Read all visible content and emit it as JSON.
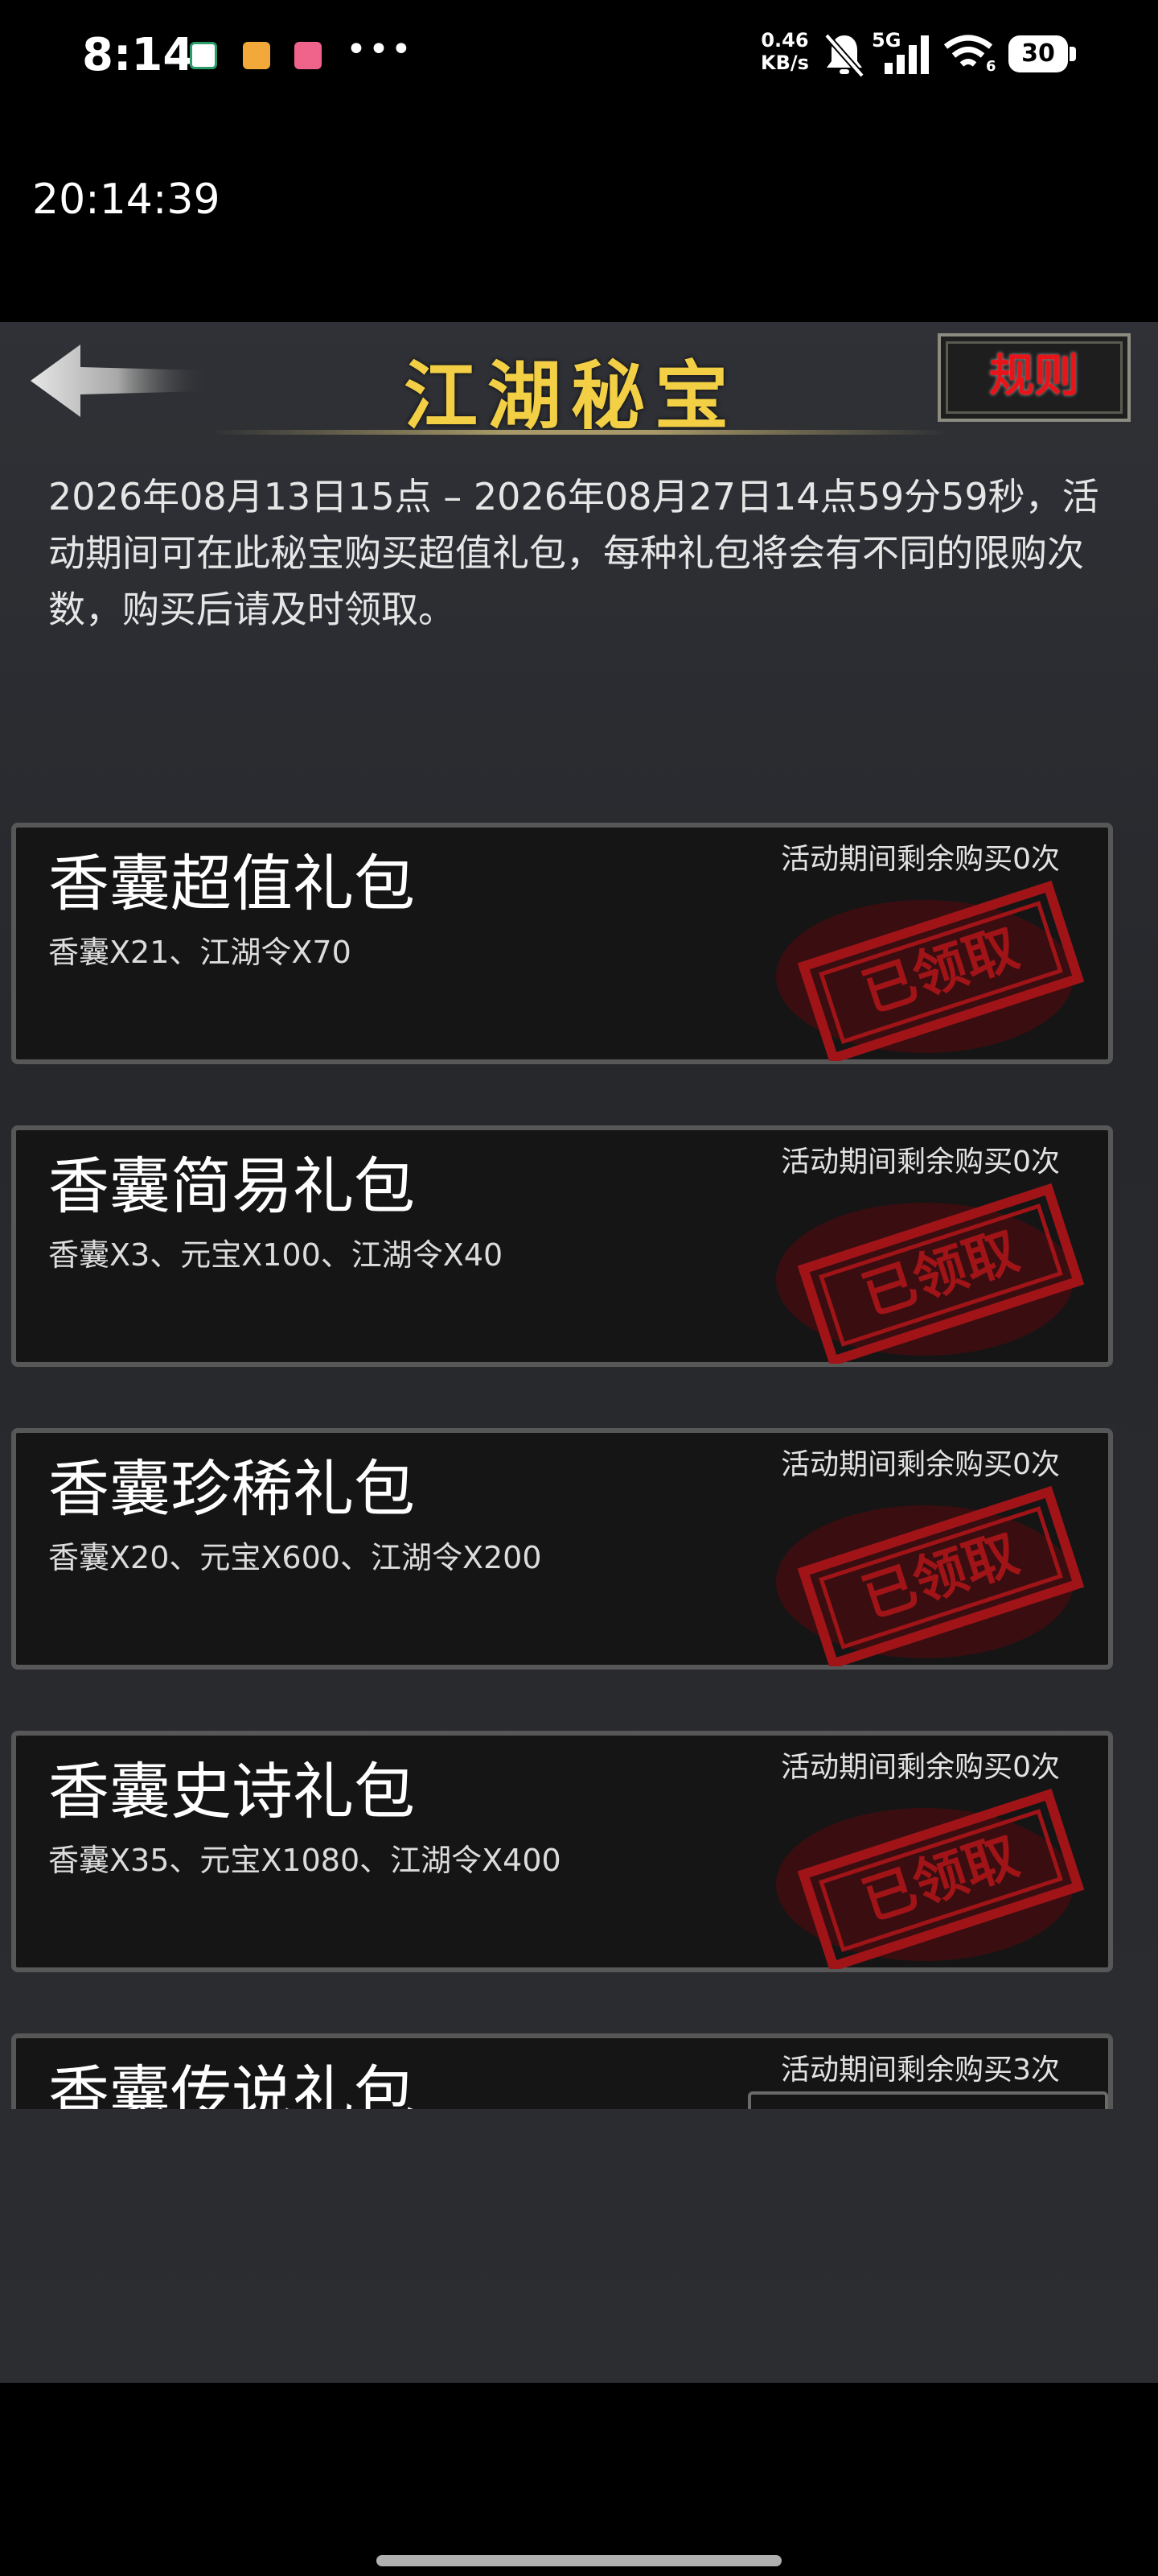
{
  "status_bar": {
    "time": "8:14",
    "notification_dots": "•••",
    "net_speed_value": "0.46",
    "net_speed_unit": "KB/s",
    "network_type": "5G",
    "wifi_level_label": "6",
    "battery": "30"
  },
  "clock_overlay": "20:14:39",
  "header": {
    "title": "江湖秘宝",
    "rules_label": "规则"
  },
  "description": "2026年08月13日15点 – 2026年08月27日14点59分59秒，活动期间可在此秘宝购买超值礼包，每种礼包将会有不同的限购次数，购买后请及时领取。",
  "packages": [
    {
      "name": "香囊超值礼包",
      "contents": "香囊X21、江湖令X70",
      "remaining": "活动期间剩余购买0次",
      "stamp": "已领取",
      "claimed": true
    },
    {
      "name": "香囊简易礼包",
      "contents": "香囊X3、元宝X100、江湖令X40",
      "remaining": "活动期间剩余购买0次",
      "stamp": "已领取",
      "claimed": true
    },
    {
      "name": "香囊珍稀礼包",
      "contents": "香囊X20、元宝X600、江湖令X200",
      "remaining": "活动期间剩余购买0次",
      "stamp": "已领取",
      "claimed": true
    },
    {
      "name": "香囊史诗礼包",
      "contents": "香囊X35、元宝X1080、江湖令X400",
      "remaining": "活动期间剩余购买0次",
      "stamp": "已领取",
      "claimed": true
    },
    {
      "name": "香囊传说礼包",
      "contents": "",
      "remaining": "活动期间剩余购买3次",
      "stamp": "",
      "claimed": false
    }
  ],
  "colors": {
    "title_gold": "#f2cf45",
    "rules_red": "#e8141a",
    "stamp_red": "#a01418",
    "card_border": "#575757"
  }
}
